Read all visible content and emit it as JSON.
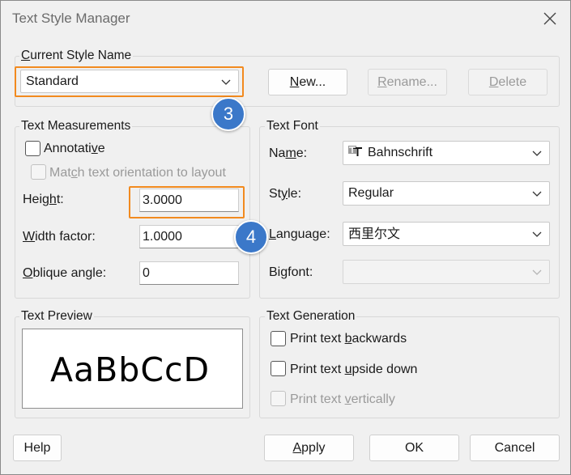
{
  "window": {
    "title": "Text Style Manager"
  },
  "current_style": {
    "group_label": "Current Style Name",
    "selected": "Standard",
    "new_button": "New...",
    "rename_button": "Rename...",
    "delete_button": "Delete"
  },
  "measurements": {
    "group_label": "Text Measurements",
    "annotative_label": "Annotative",
    "match_label": "Match text orientation to layout",
    "height_label": "Height:",
    "height_value": "3.0000",
    "width_label": "Width factor:",
    "width_value": "1.0000",
    "oblique_label": "Oblique angle:",
    "oblique_value": "0"
  },
  "font": {
    "group_label": "Text Font",
    "name_label": "Name:",
    "name_value": "Bahnschrift",
    "style_label": "Style:",
    "style_value": "Regular",
    "language_label": "Language:",
    "language_value": "西里尔文",
    "bigfont_label": "Bigfont:",
    "bigfont_value": ""
  },
  "preview": {
    "group_label": "Text Preview",
    "sample": "AaBbCcD"
  },
  "generation": {
    "group_label": "Text Generation",
    "backwards_label": "Print text backwards",
    "upside_label": "Print text upside down",
    "vertical_label": "Print text vertically"
  },
  "footer": {
    "help": "Help",
    "apply": "Apply",
    "ok": "OK",
    "cancel": "Cancel"
  },
  "callouts": {
    "first": "3",
    "second": "4"
  },
  "colors": {
    "highlight": "#f28a1f",
    "badge": "#3b78c9"
  }
}
